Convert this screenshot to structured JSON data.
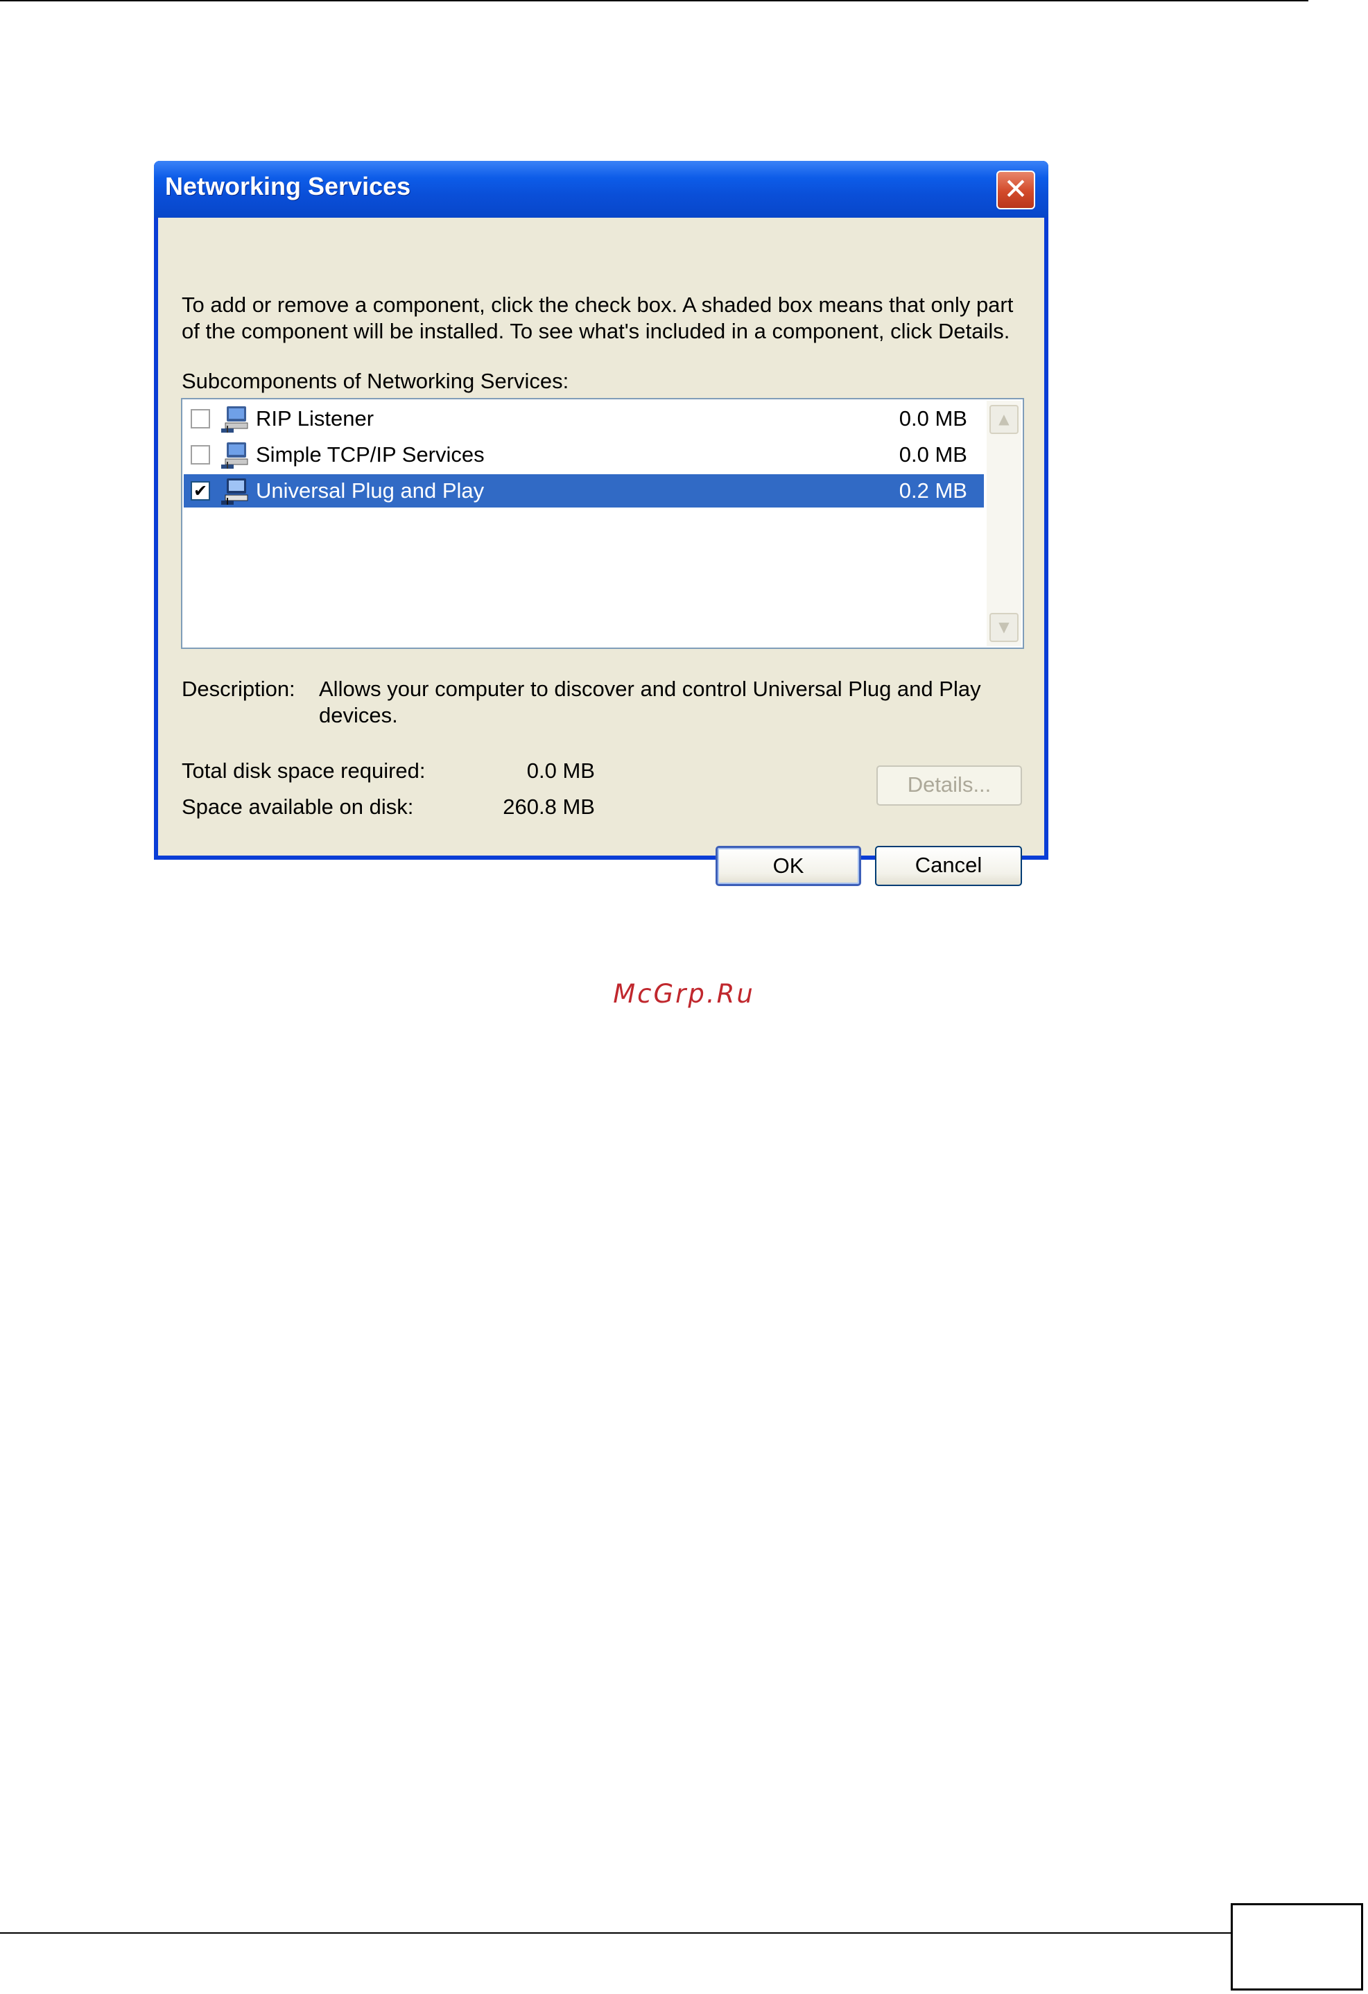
{
  "dialog": {
    "title": "Networking Services",
    "close_glyph": "✕",
    "instructions_line1": "To add or remove a component, click the check box. A shaded box means that only part",
    "instructions_line2": "of the component will be installed. To see what's included in a component, click Details.",
    "list_caption": "Subcomponents of Networking Services:",
    "components": [
      {
        "label": "RIP Listener",
        "size": "0.0 MB",
        "checked": false,
        "selected": false,
        "icon": "network-computer-icon"
      },
      {
        "label": "Simple TCP/IP Services",
        "size": "0.0 MB",
        "checked": false,
        "selected": false,
        "icon": "network-computer-icon"
      },
      {
        "label": "Universal Plug and Play",
        "size": "0.2 MB",
        "checked": true,
        "selected": true,
        "icon": "network-computer-icon"
      }
    ],
    "description_label": "Description:",
    "description_line1": "Allows your computer to discover and control Universal Plug and Play",
    "description_line2": "devices.",
    "total_disk_label": "Total disk space required:",
    "total_disk_value": "0.0 MB",
    "available_label": "Space available on disk:",
    "available_value": "260.8 MB",
    "details_button": "Details...",
    "ok_button": "OK",
    "cancel_button": "Cancel",
    "check_glyph": "✔",
    "scroll_up_glyph": "▲",
    "scroll_down_glyph": "▼"
  },
  "watermark": "McGrp.Ru",
  "colors": {
    "titlebar": "#0a4fd8",
    "client_bg": "#ece9d8",
    "selection": "#316ac5",
    "watermark": "#c0272d"
  }
}
